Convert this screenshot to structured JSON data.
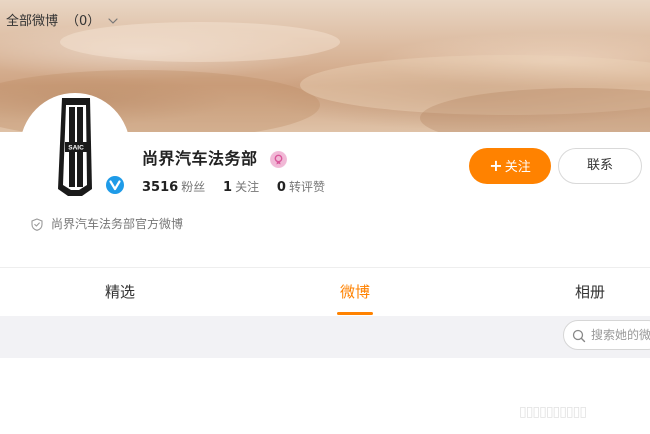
{
  "profile": {
    "name": "尚界汽车法务部",
    "logo_text": "SAIC",
    "description": "尚界汽车法务部官方微博",
    "stats": [
      {
        "value": "3516",
        "label": "粉丝"
      },
      {
        "value": "1",
        "label": "关注"
      },
      {
        "value": "0",
        "label": "转评赞"
      }
    ],
    "follow_label": "关注",
    "follow_plus": "+",
    "contact_label": "联系"
  },
  "tabs": [
    {
      "label": "精选",
      "active": false
    },
    {
      "label": "微博",
      "active": true
    },
    {
      "label": "相册",
      "active": false
    }
  ],
  "filter": {
    "label": "全部微博",
    "count": "（0）"
  },
  "search": {
    "placeholder": "搜索她的微博"
  },
  "colors": {
    "accent": "#ff8200",
    "verified": "#1e9be8",
    "filter_bg": "#f2f2f5"
  },
  "icons": {
    "verified": "verified-badge-icon",
    "level": "level-badge-icon",
    "shield": "shield-icon",
    "chevron": "chevron-down-icon",
    "search": "search-icon"
  }
}
